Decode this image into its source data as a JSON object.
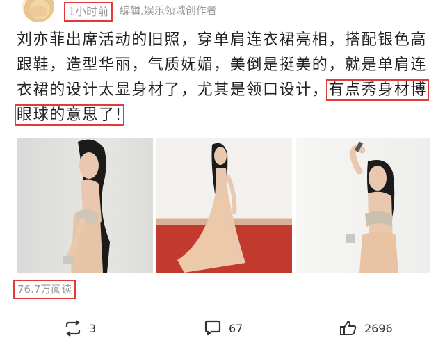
{
  "header": {
    "time": "1小时前",
    "meta": "编辑,娱乐领域创作者"
  },
  "post": {
    "text_plain": "刘亦菲出席活动的旧照，穿单肩连衣裙亮相，搭配银色高跟鞋，造型华丽，气质妩媚，美倒是挺美的，就是单肩连衣裙的设计太显身材了，尤其是领口设计，",
    "text_highlight": "有点秀身材博眼球的意思了!"
  },
  "stats": {
    "reads": "76.7万阅读"
  },
  "actions": {
    "repost_icon": "repost-icon",
    "repost_count": "3",
    "comment_icon": "comment-icon",
    "comment_count": "67",
    "like_icon": "thumbs-up-icon",
    "like_count": "2696"
  },
  "colors": {
    "highlight_border": "#e23a3a",
    "meta_text": "#999999"
  }
}
